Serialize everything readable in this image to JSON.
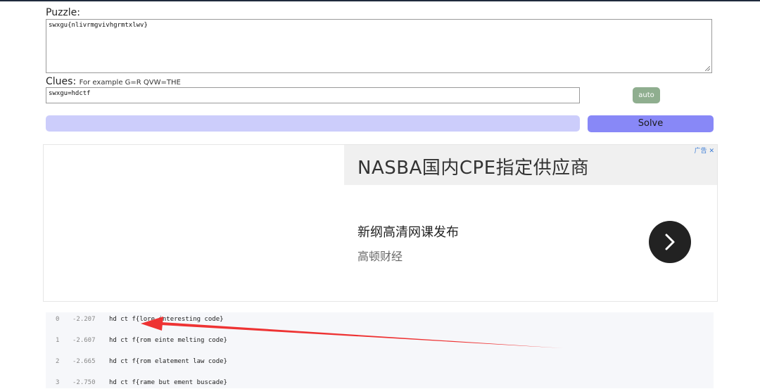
{
  "labels": {
    "puzzle": "Puzzle:",
    "clues": "Clues:",
    "clues_example": "For example G=R QVW=THE"
  },
  "puzzle": {
    "value": "swxgu{nlivrmgvivhgrmtxlwv}"
  },
  "clues": {
    "value": "swxgu=hdctf"
  },
  "buttons": {
    "auto": "auto",
    "solve": "Solve"
  },
  "ad": {
    "title": "NASBA国内CPE指定供应商",
    "line1": "新纲高清网课发布",
    "line2": "高顿财经",
    "badge": "广告",
    "close": "✕"
  },
  "results": [
    {
      "index": "0",
      "score": "-2.207",
      "text": "hd ct f{lore interesting code}"
    },
    {
      "index": "1",
      "score": "-2.607",
      "text": "hd ct f{rom einte melting code}"
    },
    {
      "index": "2",
      "score": "-2.665",
      "text": "hd ct f{rom elatement law code}"
    },
    {
      "index": "3",
      "score": "-2.750",
      "text": "hd ct f{rame but ement buscade}"
    }
  ],
  "colors": {
    "auto_button": "#8fae8f",
    "solve_button": "#8888f7",
    "progress": "#cccdfb",
    "arrow": "#ee3333"
  }
}
